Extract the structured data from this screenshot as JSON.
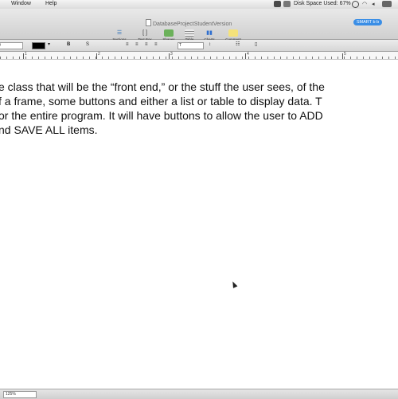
{
  "menubar": {
    "items": [
      "Window",
      "Help"
    ],
    "status": "Disk Space Used: 67%"
  },
  "window": {
    "title": "DatabaseProjectStudentVersion",
    "spotlight_label": "SMART b b"
  },
  "toolbar": {
    "buttons": [
      {
        "label": "Sections",
        "icon": "sections-icon"
      },
      {
        "label": "Text Box",
        "icon": "text-box-icon"
      },
      {
        "label": "Shapes",
        "icon": "shapes-icon"
      },
      {
        "label": "Table",
        "icon": "table-icon"
      },
      {
        "label": "Charts",
        "icon": "charts-icon"
      },
      {
        "label": "Comment",
        "icon": "comment-icon"
      }
    ]
  },
  "formatbar": {
    "font_size": "0",
    "style_box": "T",
    "text_color": "#000000"
  },
  "ruler": {
    "numbers": [
      "1",
      "2",
      "3",
      "4",
      "5"
    ]
  },
  "document": {
    "lines": [
      "e class that will be the “front end,” or the stuff the user sees, of the",
      "f a frame, some buttons and either a list or table to display data.  T",
      "or the entire program. It will have buttons to allow the user to ADD",
      "nd SAVE ALL items."
    ]
  },
  "bottombar": {
    "zoom": "125%"
  }
}
